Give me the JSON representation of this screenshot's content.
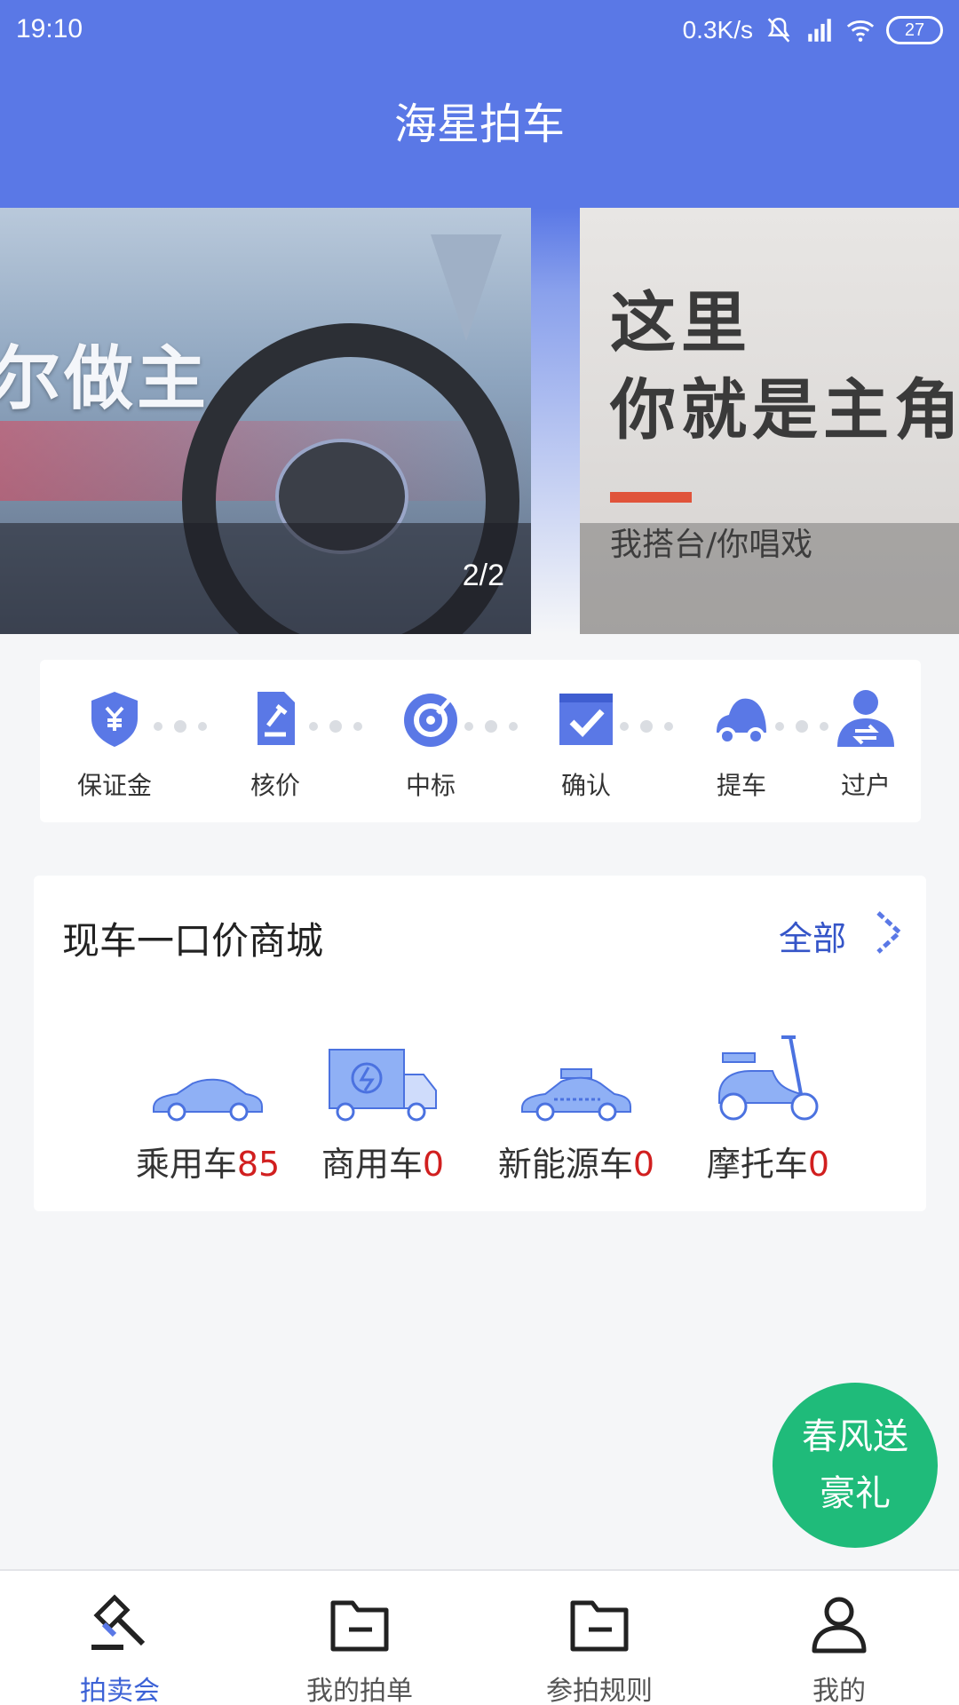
{
  "status_bar": {
    "time": "19:10",
    "network_speed": "0.3K/s",
    "battery": "27"
  },
  "header": {
    "title": "海星拍车"
  },
  "banner": {
    "left_slide_text": "尔做主",
    "counter": "2/2",
    "right_slide_line1": "这里",
    "right_slide_line2": "你就是主角",
    "right_slide_sub": "我搭台/你唱戏"
  },
  "steps": [
    {
      "label": "保证金",
      "icon": "deposit-shield-icon"
    },
    {
      "label": "核价",
      "icon": "price-check-icon"
    },
    {
      "label": "中标",
      "icon": "win-bid-icon"
    },
    {
      "label": "确认",
      "icon": "confirm-icon"
    },
    {
      "label": "提车",
      "icon": "pickup-car-icon"
    },
    {
      "label": "过户",
      "icon": "transfer-user-icon"
    }
  ],
  "mall": {
    "title": "现车一口价商城",
    "all_label": "全部",
    "items": [
      {
        "label": "乘用车",
        "count": "85",
        "icon": "sedan-icon"
      },
      {
        "label": "商用车",
        "count": "0",
        "icon": "truck-icon"
      },
      {
        "label": "新能源车",
        "count": "0",
        "icon": "taxi-icon"
      },
      {
        "label": "摩托车",
        "count": "0",
        "icon": "scooter-icon"
      }
    ]
  },
  "promo": {
    "line1": "春风送",
    "line2": "豪礼"
  },
  "bottom_nav": [
    {
      "label": "拍卖会",
      "active": true,
      "icon": "auction-gavel-icon"
    },
    {
      "label": "我的拍单",
      "active": false,
      "icon": "folder-icon"
    },
    {
      "label": "参拍规则",
      "active": false,
      "icon": "folder-icon"
    },
    {
      "label": "我的",
      "active": false,
      "icon": "user-icon"
    }
  ],
  "colors": {
    "primary": "#5a78e6",
    "accent_blue": "#3c62d6",
    "count_red": "#d11f1f",
    "promo_green": "#1fbb7a"
  }
}
